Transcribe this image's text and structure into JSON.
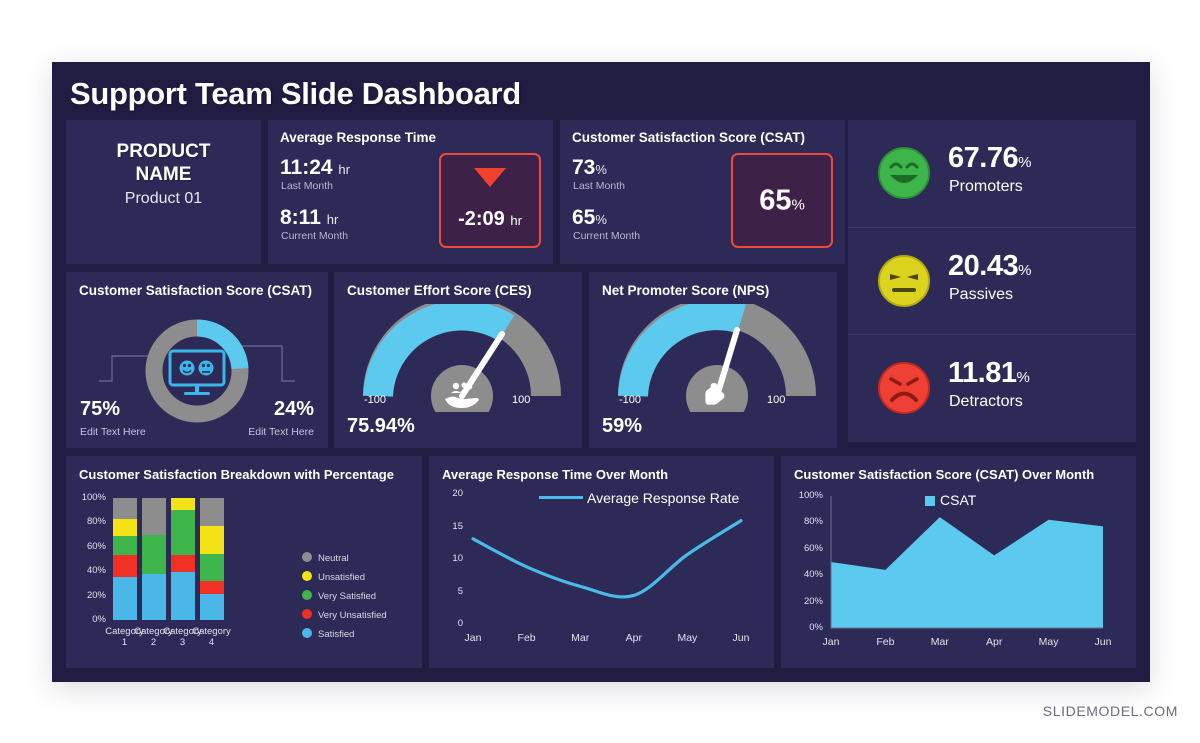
{
  "slide": {
    "title": "Support Team Slide Dashboard",
    "background_color": "#211c42",
    "card_color": "#2d2a57",
    "accent_blue": "#5cc9ef",
    "accent_red": "#f0483a",
    "accent_gray": "#8d8d8d"
  },
  "product": {
    "title_line1": "PRODUCT",
    "title_line2": "NAME",
    "value": "Product  01"
  },
  "response_time": {
    "title": "Average Response Time",
    "last_value": "11:24",
    "last_unit": "hr",
    "last_label": "Last Month",
    "current_value": "8:11",
    "current_unit": "hr",
    "current_label": "Current Month",
    "delta_value": "-2:09",
    "delta_unit": "hr",
    "delta_direction": "down"
  },
  "csat_kpi": {
    "title": "Customer Satisfaction Score (CSAT)",
    "last_value": "73",
    "last_unit": "%",
    "last_label": "Last Month",
    "current_value": "65",
    "current_unit": "%",
    "current_label": "Current Month",
    "highlight_value": "65",
    "highlight_unit": "%"
  },
  "nps_panel": {
    "rows": [
      {
        "value": "67.76",
        "unit": "%",
        "label": "Promoters",
        "face": "smile-face-icon",
        "color": "#3eb54b"
      },
      {
        "value": "20.43",
        "unit": "%",
        "label": "Passives",
        "face": "neutral-face-icon",
        "color": "#dcd31e"
      },
      {
        "value": "11.81",
        "unit": "%",
        "label": "Detractors",
        "face": "sad-face-icon",
        "color": "#ef4035"
      }
    ]
  },
  "csat_donut": {
    "title": "Customer Satisfaction Score (CSAT)",
    "left_value": "75%",
    "left_caption": "Edit Text Here",
    "right_value": "24%",
    "right_caption": "Edit Text Here",
    "blue_pct": 24,
    "gray_pct": 76,
    "center_icon": "monitor-faces-icon"
  },
  "ces_gauge": {
    "title": "Customer Effort Score (CES)",
    "min_label": "-100",
    "max_label": "100",
    "value_label": "75.94%",
    "value": 75.94,
    "center_icon": "hand-users-icon"
  },
  "nps_gauge": {
    "title": "Net Promoter Score (NPS)",
    "min_label": "-100",
    "max_label": "100",
    "value_label": "59%",
    "value": 59,
    "center_icon": "pointing-hand-icon"
  },
  "chart_data": [
    {
      "id": "breakdown",
      "type": "bar",
      "stacked": true,
      "title": "Customer Satisfaction Breakdown with Percentage",
      "xlabel": "",
      "ylabel": "",
      "ylim": [
        0,
        100
      ],
      "yticks": [
        "0%",
        "20%",
        "40%",
        "60%",
        "80%",
        "100%"
      ],
      "grid": false,
      "legend_position": "right",
      "categories": [
        "Category 1",
        "Category 2",
        "Category 3",
        "Category 4"
      ],
      "series": [
        {
          "name": "Satisfied",
          "color": "#4ab7e8",
          "values": [
            35,
            38,
            39,
            21
          ]
        },
        {
          "name": "Very Unsatisfied",
          "color": "#ee3124",
          "values": [
            18,
            0,
            14,
            11
          ]
        },
        {
          "name": "Very Satisfied",
          "color": "#3eb54b",
          "values": [
            16,
            32,
            37,
            22
          ]
        },
        {
          "name": "Unsatisfied",
          "color": "#f3e216",
          "values": [
            14,
            0,
            10,
            23
          ]
        },
        {
          "name": "Neutral",
          "color": "#8d8d8d",
          "values": [
            17,
            30,
            0,
            23
          ]
        }
      ],
      "legend_order": [
        "Neutral",
        "Unsatisfied",
        "Very Satisfied",
        "Very Unsatisfied",
        "Satisfied"
      ]
    },
    {
      "id": "response-over-month",
      "type": "line",
      "title": "Average Response Time Over Month",
      "xlabel": "",
      "ylabel": "",
      "ylim": [
        0,
        20
      ],
      "yticks": [
        "0",
        "5",
        "10",
        "15",
        "20"
      ],
      "grid": false,
      "legend_position": "top",
      "x": [
        "Jan",
        "Feb",
        "Mar",
        "Apr",
        "May",
        "Jun"
      ],
      "series": [
        {
          "name": "Average Response Rate",
          "color": "#49bbe8",
          "values": [
            13.1,
            8.8,
            5.8,
            4.4,
            10.7,
            15.9
          ]
        }
      ]
    },
    {
      "id": "csat-over-month",
      "type": "area",
      "title": "Customer Satisfaction Score (CSAT) Over Month",
      "xlabel": "",
      "ylabel": "",
      "ylim": [
        0,
        100
      ],
      "yticks": [
        "0%",
        "20%",
        "40%",
        "60%",
        "80%",
        "100%"
      ],
      "grid": false,
      "legend_position": "top",
      "x": [
        "Jan",
        "Feb",
        "Mar",
        "Apr",
        "May",
        "Jun"
      ],
      "series": [
        {
          "name": "CSAT",
          "color": "#5cc9ef",
          "values": [
            50,
            44,
            84,
            55,
            82,
            77
          ]
        }
      ]
    }
  ],
  "footer": {
    "text": "SLIDEMODEL.COM"
  }
}
